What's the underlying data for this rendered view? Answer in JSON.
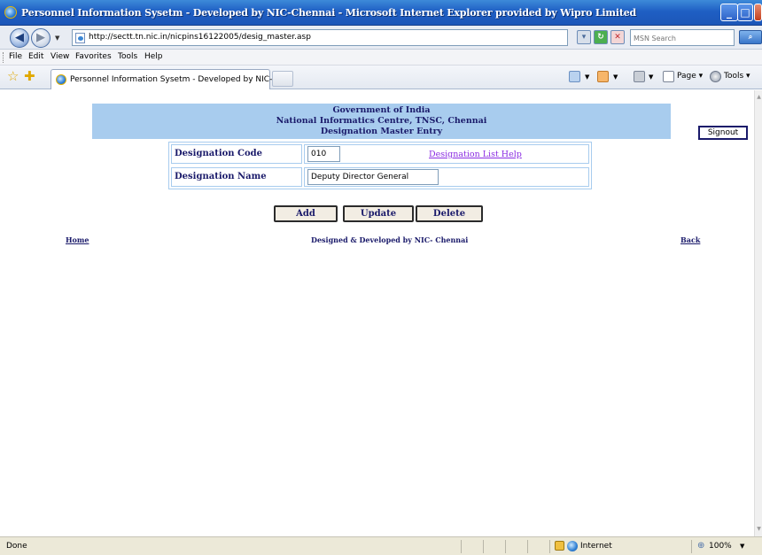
{
  "window": {
    "title": "Personnel Information Sysetm - Developed by NIC-Chennai - Microsoft Internet Explorer provided by Wipro Limited"
  },
  "address": {
    "url": "http://sectt.tn.nic.in/nicpins16122005/desig_master.asp",
    "search_placeholder": "MSN Search"
  },
  "menu": [
    "File",
    "Edit",
    "View",
    "Favorites",
    "Tools",
    "Help"
  ],
  "tab": {
    "label": "Personnel Information Sysetm - Developed by NIC-Ch..."
  },
  "commandbar": {
    "page_label": "Page",
    "tools_label": "Tools"
  },
  "header": {
    "line1": "Government of India",
    "line2": "National Informatics Centre, TNSC, Chennai",
    "line3": "Designation Master Entry"
  },
  "signout_label": "Signout",
  "form": {
    "code_label": "Designation Code",
    "code_value": "010",
    "help_link": "Designation List Help",
    "name_label": "Designation Name",
    "name_value": "Deputy Director General"
  },
  "buttons": {
    "add": "Add",
    "update": "Update",
    "delete": "Delete"
  },
  "footer": {
    "home": "Home",
    "credit": "Designed & Developed by NIC- Chennai",
    "back": "Back"
  },
  "status": {
    "text": "Done",
    "zone": "Internet",
    "zoom": "100%"
  }
}
